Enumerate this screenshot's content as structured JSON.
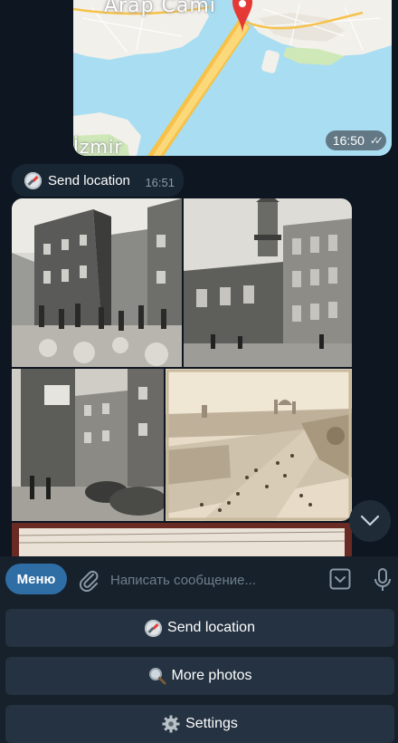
{
  "map_message": {
    "labels": [
      "Arap Cami",
      "İzmir"
    ],
    "time": "16:50",
    "status": "read"
  },
  "location_message": {
    "icon": "compass-icon",
    "text": "Send location",
    "time": "16:51"
  },
  "photos": [
    {
      "name": "photo-street-crowd"
    },
    {
      "name": "photo-mosque-building"
    },
    {
      "name": "photo-street-cars"
    },
    {
      "name": "photo-bridge-panorama"
    },
    {
      "name": "photo-partial"
    }
  ],
  "input_bar": {
    "menu_label": "Меню",
    "placeholder": "Написать сообщение..."
  },
  "bot_keyboard": {
    "buttons": [
      {
        "icon": "compass-icon",
        "label": "Send location"
      },
      {
        "icon": "magnifier-icon",
        "label": "More photos"
      },
      {
        "icon": "gear-icon",
        "label": "Settings"
      }
    ]
  },
  "colors": {
    "background": "#0e1621",
    "bubble": "#182533",
    "input_bar": "#17212b",
    "menu_button": "#2f6ea5",
    "keyboard_button": "#243241",
    "map_pin": "#e53935"
  }
}
